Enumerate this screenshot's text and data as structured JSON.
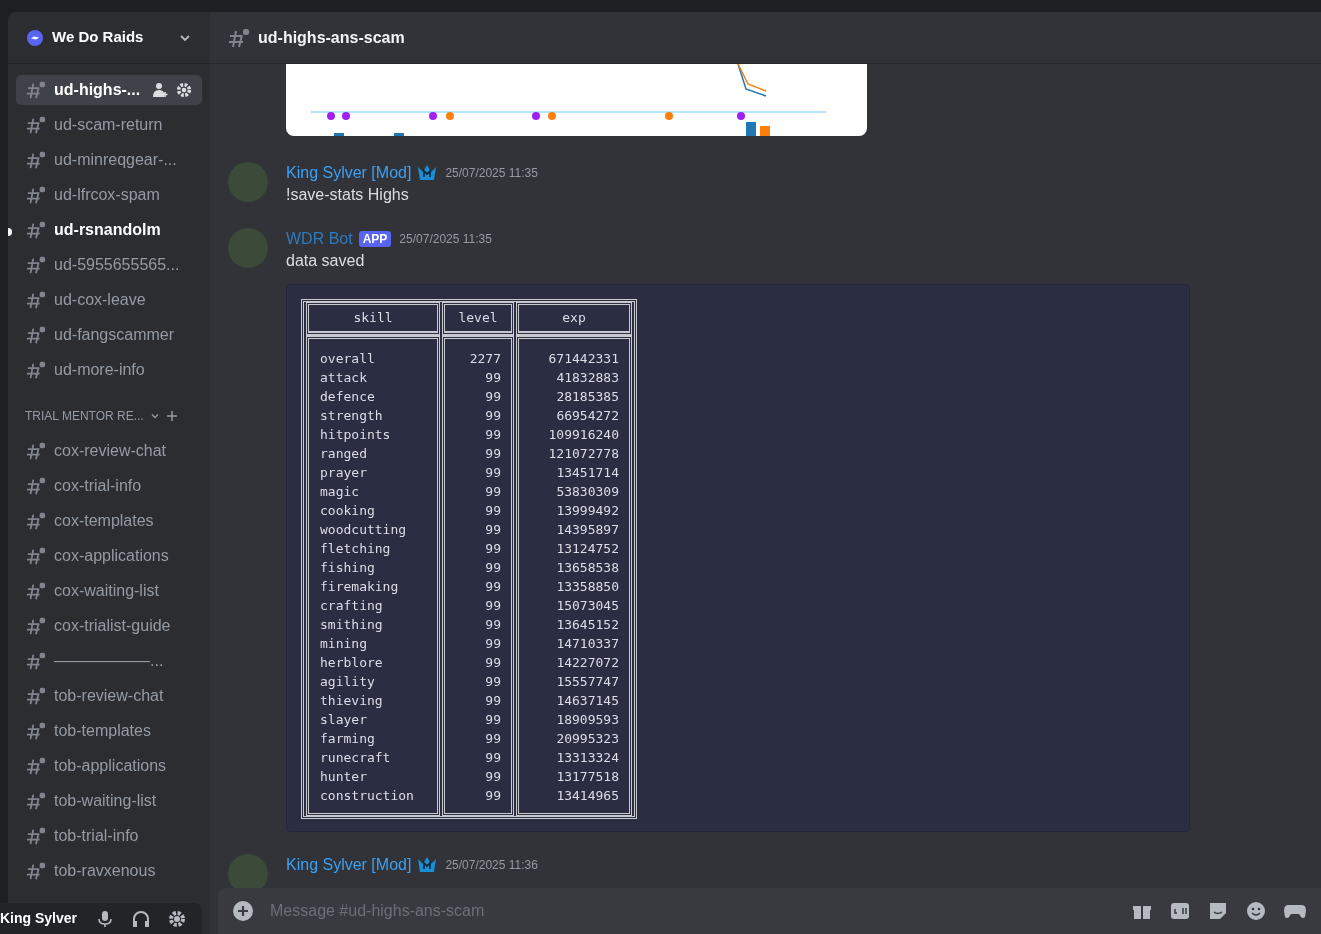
{
  "server": {
    "name": "We Do Raids"
  },
  "sidebar": {
    "items": [
      {
        "kind": "channel",
        "name": "ud-highs-...",
        "selected": true,
        "unread": false
      },
      {
        "kind": "channel",
        "name": "ud-scam-return",
        "selected": false,
        "unread": false
      },
      {
        "kind": "channel",
        "name": "ud-minreqgear-...",
        "selected": false,
        "unread": false
      },
      {
        "kind": "channel",
        "name": "ud-lfrcox-spam",
        "selected": false,
        "unread": false
      },
      {
        "kind": "channel",
        "name": "ud-rsnandolm",
        "selected": false,
        "unread": true
      },
      {
        "kind": "channel",
        "name": "ud-5955655565...",
        "selected": false,
        "unread": false
      },
      {
        "kind": "channel",
        "name": "ud-cox-leave",
        "selected": false,
        "unread": false
      },
      {
        "kind": "channel",
        "name": "ud-fangscammer",
        "selected": false,
        "unread": false
      },
      {
        "kind": "channel",
        "name": "ud-more-info",
        "selected": false,
        "unread": false
      },
      {
        "kind": "category",
        "name": "TRIAL MENTOR RE..."
      },
      {
        "kind": "channel",
        "name": "cox-review-chat",
        "selected": false,
        "unread": false
      },
      {
        "kind": "channel",
        "name": "cox-trial-info",
        "selected": false,
        "unread": false
      },
      {
        "kind": "channel",
        "name": "cox-templates",
        "selected": false,
        "unread": false
      },
      {
        "kind": "channel",
        "name": "cox-applications",
        "selected": false,
        "unread": false
      },
      {
        "kind": "channel",
        "name": "cox-waiting-list",
        "selected": false,
        "unread": false
      },
      {
        "kind": "channel",
        "name": "cox-trialist-guide",
        "selected": false,
        "unread": false
      },
      {
        "kind": "channel",
        "name": "——————...",
        "selected": false,
        "unread": false
      },
      {
        "kind": "channel",
        "name": "tob-review-chat",
        "selected": false,
        "unread": false
      },
      {
        "kind": "channel",
        "name": "tob-templates",
        "selected": false,
        "unread": false
      },
      {
        "kind": "channel",
        "name": "tob-applications",
        "selected": false,
        "unread": false
      },
      {
        "kind": "channel",
        "name": "tob-waiting-list",
        "selected": false,
        "unread": false
      },
      {
        "kind": "channel",
        "name": "tob-trial-info",
        "selected": false,
        "unread": false
      },
      {
        "kind": "channel",
        "name": "tob-ravxenous",
        "selected": false,
        "unread": false
      }
    ]
  },
  "user_panel": {
    "username": "King Sylver"
  },
  "channel_header": {
    "title": "ud-highs-ans-scam"
  },
  "messages": [
    {
      "author": "King Sylver [Mod]",
      "color": "#3ba1f5",
      "badge": {
        "kind": "crown"
      },
      "timestamp": "25/07/2025 11:35",
      "text": "!save-stats Highs"
    },
    {
      "author": "WDR Bot",
      "color": "#2e7bbf",
      "badge": {
        "kind": "app",
        "label": "APP"
      },
      "timestamp": "25/07/2025 11:35",
      "text": "data saved",
      "table": {
        "columns": [
          "skill",
          "level",
          "exp"
        ],
        "rows": [
          [
            "overall",
            "2277",
            "671442331"
          ],
          [
            "attack",
            "99",
            "41832883"
          ],
          [
            "defence",
            "99",
            "28185385"
          ],
          [
            "strength",
            "99",
            "66954272"
          ],
          [
            "hitpoints",
            "99",
            "109916240"
          ],
          [
            "ranged",
            "99",
            "121072778"
          ],
          [
            "prayer",
            "99",
            "13451714"
          ],
          [
            "magic",
            "99",
            "53830309"
          ],
          [
            "cooking",
            "99",
            "13999492"
          ],
          [
            "woodcutting",
            "99",
            "14395897"
          ],
          [
            "fletching",
            "99",
            "13124752"
          ],
          [
            "fishing",
            "99",
            "13658538"
          ],
          [
            "firemaking",
            "99",
            "13358850"
          ],
          [
            "crafting",
            "99",
            "15073045"
          ],
          [
            "smithing",
            "99",
            "13645152"
          ],
          [
            "mining",
            "99",
            "14710337"
          ],
          [
            "herblore",
            "99",
            "14227072"
          ],
          [
            "agility",
            "99",
            "15557747"
          ],
          [
            "thieving",
            "99",
            "14637145"
          ],
          [
            "slayer",
            "99",
            "18909593"
          ],
          [
            "farming",
            "99",
            "20995323"
          ],
          [
            "runecraft",
            "99",
            "13313324"
          ],
          [
            "hunter",
            "99",
            "13177518"
          ],
          [
            "construction",
            "99",
            "13414965"
          ]
        ]
      }
    },
    {
      "author": "King Sylver [Mod]",
      "color": "#3ba1f5",
      "badge": {
        "kind": "crown"
      },
      "timestamp": "25/07/2025 11:36"
    }
  ],
  "composer": {
    "placeholder": "Message #ud-highs-ans-scam"
  }
}
